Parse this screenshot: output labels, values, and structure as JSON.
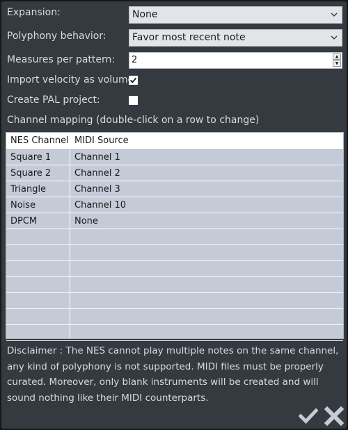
{
  "form": {
    "expansion_label": "Expansion:",
    "expansion_value": "None",
    "polyphony_label": "Polyphony behavior:",
    "polyphony_value": "Favor most recent note",
    "measures_label": "Measures per pattern:",
    "measures_value": "2",
    "velocity_label": "Import velocity as volume:",
    "velocity_checked": true,
    "pal_label": "Create PAL project:",
    "pal_checked": false
  },
  "mapping": {
    "heading": "Channel mapping (double-click on a row to change)",
    "columns": [
      "NES Channel",
      "MIDI Source"
    ],
    "rows": [
      [
        "Square 1",
        "Channel 1"
      ],
      [
        "Square 2",
        "Channel 2"
      ],
      [
        "Triangle",
        "Channel 3"
      ],
      [
        "Noise",
        "Channel 10"
      ],
      [
        "DPCM",
        "None"
      ]
    ]
  },
  "disclaimer": "Disclaimer : The NES cannot play multiple notes on the same channel, any kind of polyphony is not supported. MIDI files must be properly curated. Moreover, only blank instruments will be created and will sound nothing like their MIDI counterparts.",
  "icons": {
    "ok": "checkmark-icon",
    "cancel": "close-icon"
  },
  "colors": {
    "dialog_bg": "#343a40",
    "grid_bg": "#c4cbd6",
    "text": "#d8dade"
  }
}
